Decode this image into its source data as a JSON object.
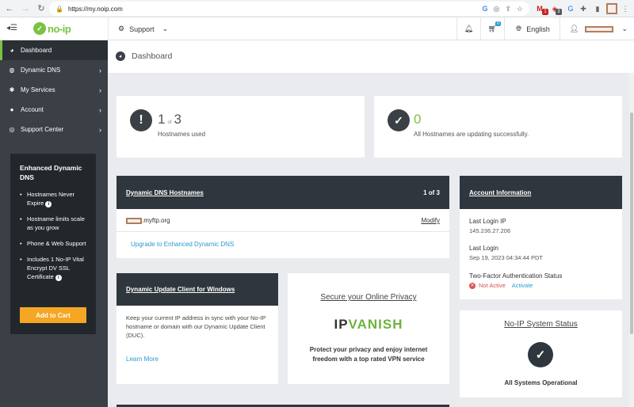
{
  "browser": {
    "url": "https://my.noip.com",
    "ext_badge_1": "1",
    "ext_badge_2": "3"
  },
  "header": {
    "logo_text": "no-ip",
    "support_label": "Support",
    "cart_count": "0",
    "language_label": "English"
  },
  "sidebar": {
    "items": [
      {
        "label": "Dashboard",
        "icon": "dashboard-icon"
      },
      {
        "label": "Dynamic DNS",
        "icon": "globe-icon"
      },
      {
        "label": "My Services",
        "icon": "gear-icon"
      },
      {
        "label": "Account",
        "icon": "user-icon"
      },
      {
        "label": "Support Center",
        "icon": "lifebuoy-icon"
      }
    ],
    "promo": {
      "title": "Enhanced Dynamic DNS",
      "features": [
        "Hostnames Never Expire",
        "Hostname limits scale as you grow",
        "Phone & Web Support",
        "Includes 1 No-IP Vital Encrypt DV SSL Certificate"
      ],
      "cta": "Add to Cart"
    }
  },
  "page": {
    "title": "Dashboard"
  },
  "stats": {
    "hostnames_used": "1",
    "of": "of",
    "hostnames_total": "3",
    "hostnames_label": "Hostnames used",
    "updating_count": "0",
    "updating_label": "All Hostnames are updating successfully."
  },
  "ddns": {
    "title": "Dynamic DNS Hostnames",
    "pager": "1 of 3",
    "hostname": ".myftp.org",
    "modify": "Modify",
    "upgrade": "Upgrade to Enhanced Dynamic DNS"
  },
  "account": {
    "title": "Account Information",
    "last_login_ip_label": "Last Login IP",
    "last_login_ip": "145.236.27.206",
    "last_login_label": "Last Login",
    "last_login": "Sep 19, 2023 04:34:44 PDT",
    "tfa_label": "Two-Factor Authentication Status",
    "tfa_status": "Not Active",
    "tfa_action": "Activate"
  },
  "duc": {
    "title": "Dynamic Update Client for Windows",
    "body": "Keep your current IP address in sync with your No-IP hostname or domain with our Dynamic Update Client (DUC).",
    "link": "Learn More"
  },
  "vpn": {
    "title": "Secure your Online Privacy",
    "brand_1": "IP",
    "brand_2": "VANISH",
    "body": "Protect your privacy and enjoy internet freedom with a top rated VPN service"
  },
  "system": {
    "title": "No-IP System Status",
    "status": "All Systems Operational"
  },
  "colors": {
    "accent_green": "#7cc242",
    "sidebar_bg": "#3a4046",
    "cta_orange": "#f5a623",
    "link_blue": "#2a9bd3",
    "error_red": "#d9534f"
  }
}
